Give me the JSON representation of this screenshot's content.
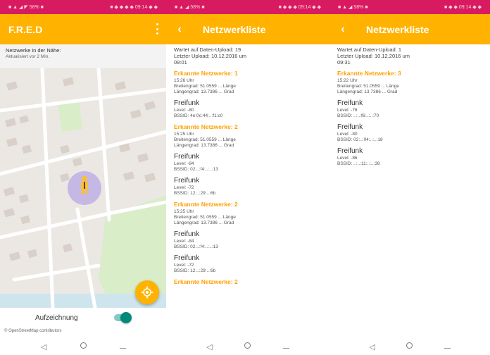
{
  "colors": {
    "status_bar": "#d81b60",
    "app_bar": "#ffb300",
    "accent_title": "#ffa000",
    "toggle_on": "#00897b"
  },
  "panel1": {
    "status_left": "■ ▲ ◢ ◤ 58% ■",
    "status_right": "■ ◆ ◆ ◆ ◆ 09:14 ◆ ◆",
    "app_title": "F.R.E.D",
    "netinfo_line1": "Netzwerke in der Nähe:",
    "netinfo_line2": "Aktualisiert vor 2 Min.",
    "recording_label": "Aufzeichnung",
    "attribution": "© OpenStreetMap contributors",
    "icons": [
      "menu-icon",
      "person-icon",
      "gps-fix-icon",
      "back-icon",
      "home-icon",
      "recents-icon"
    ]
  },
  "panel2": {
    "status_left": "■ ▲ ◢ 58% ■",
    "status_right": "■ ◆ ◆ ◆ 09:14 ◆ ◆",
    "app_title": "Netzwerkliste",
    "header_line1": "Wartet auf Daten-Upload: 19",
    "header_line2": "Letzter Upload: 10.12.2016 um",
    "header_line3": "09:01",
    "sections": [
      {
        "title": "Erkannte Netzwerke: 1",
        "details": [
          "15:26 Uhr",
          "Breitengrad: 51.0559 ... Länge",
          "Längengrad: 13.7386 ... Grad"
        ],
        "networks": [
          {
            "name": "Freifunk",
            "details": [
              "Level: -80",
              "BSSID: 4e:0c:44:..:f1:c0"
            ]
          }
        ]
      },
      {
        "title": "Erkannte Netzwerke: 2",
        "details": [
          "15:25 Uhr",
          "Breitengrad: 51.0559 ... Länge",
          "Längengrad: 13.7386 ... Grad"
        ],
        "networks": [
          {
            "name": "Freifunk",
            "details": [
              "Level: -84",
              "BSSID: 02:..:f4:..:..:13"
            ]
          },
          {
            "name": "Freifunk",
            "details": [
              "Level: -72",
              "BSSID: 12:..:29:..:6b"
            ]
          }
        ]
      },
      {
        "title": "Erkannte Netzwerke: 2",
        "details": [
          "15:25 Uhr",
          "Breitengrad: 51.0559 ... Länge",
          "Längengrad: 13.7386 ... Grad"
        ],
        "networks": [
          {
            "name": "Freifunk",
            "details": [
              "Level: -84",
              "BSSID: 02:..:f4:..:..:13"
            ]
          },
          {
            "name": "Freifunk",
            "details": [
              "Level: -72",
              "BSSID: 12:..:29:..:6b"
            ]
          }
        ]
      },
      {
        "title": "Erkannte Netzwerke: 2",
        "details": [],
        "networks": []
      }
    ]
  },
  "panel3": {
    "status_left": "■ ▲ ◢ 58% ■",
    "status_right": "■ ◆ ◆ 09:14 ◆ ◆",
    "app_title": "Netzwerkliste",
    "header_line1": "Wartet auf Daten-Upload: 1",
    "header_line2": "Letzter Upload: 10.12.2016 um",
    "header_line3": "09:31",
    "sections": [
      {
        "title": "Erkannte Netzwerke: 3",
        "details": [
          "15:22 Uhr",
          "Breitengrad: 51.0559 ... Länge",
          "Längengrad: 13.7386 ... Grad"
        ],
        "networks": [
          {
            "name": "Freifunk",
            "details": [
              "Level: -76",
              "BSSID: ..:..:f6:..:..:70"
            ]
          },
          {
            "name": "Freifunk",
            "details": [
              "Level: -80",
              "BSSID: 02:..:04:..:..:18"
            ]
          },
          {
            "name": "Freifunk",
            "details": [
              "Level: -86",
              "BSSID: ..:..:11:..:..:38"
            ]
          }
        ]
      }
    ]
  }
}
